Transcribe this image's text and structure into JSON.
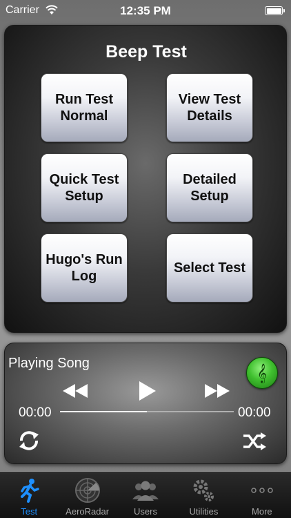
{
  "status_bar": {
    "carrier": "Carrier",
    "time": "12:35 PM"
  },
  "main": {
    "title": "Beep Test",
    "buttons": [
      {
        "label": "Run Test\nNormal"
      },
      {
        "label": "View Test\nDetails"
      },
      {
        "label": "Quick Test\nSetup"
      },
      {
        "label": "Detailed\nSetup"
      },
      {
        "label": "Hugo's Run\nLog"
      },
      {
        "label": "Select Test"
      }
    ]
  },
  "player": {
    "song_title": "Playing Song",
    "time_start": "00:00",
    "time_end": "00:00",
    "progress": 0.5,
    "music_icon": "treble-clef-icon"
  },
  "tab_bar": {
    "tabs": [
      {
        "label": "Test",
        "icon": "runner-icon",
        "active": true
      },
      {
        "label": "AeroRadar",
        "icon": "radar-icon",
        "active": false
      },
      {
        "label": "Users",
        "icon": "users-icon",
        "active": false
      },
      {
        "label": "Utilities",
        "icon": "gears-icon",
        "active": false
      },
      {
        "label": "More",
        "icon": "more-dots-icon",
        "active": false
      }
    ]
  },
  "colors": {
    "accent": "#1e90ff",
    "music_button": "#3fbf2e",
    "tab_inactive": "#a8a8a8"
  }
}
